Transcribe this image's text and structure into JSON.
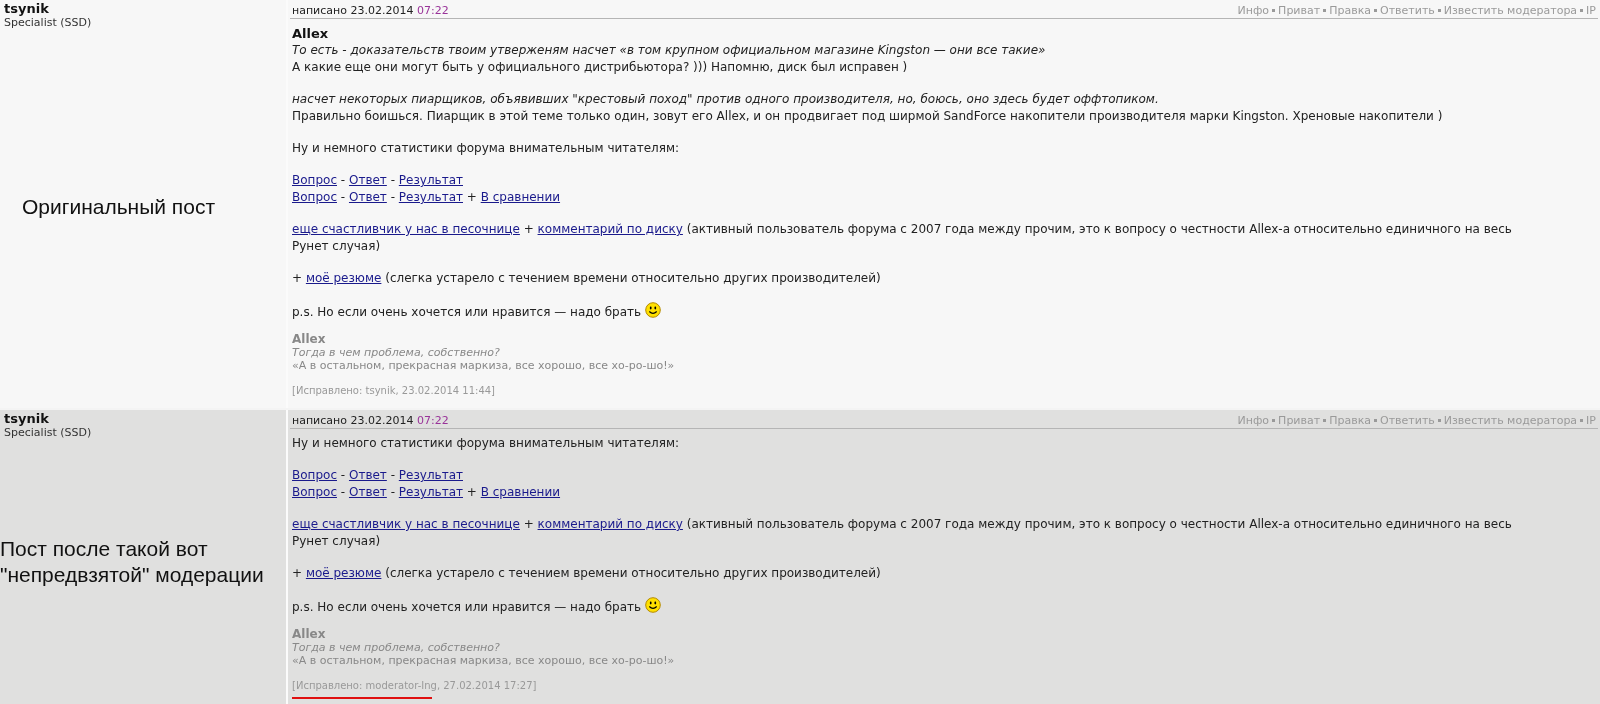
{
  "posts": [
    {
      "author": "tsynik",
      "rank": "Specialist (SSD)",
      "annotation": [
        "Оригинальный пост"
      ],
      "date": "написано 23.02.2014",
      "time": "07:22",
      "actions": [
        "Инфо",
        "Приват",
        "Правка",
        "Ответить",
        "Известить модератора",
        "IP"
      ],
      "body": [
        [
          {
            "kind": "author",
            "segments": [
              {
                "text": "Allex",
                "link": false
              }
            ]
          },
          {
            "kind": "quote",
            "segments": [
              {
                "text": "То есть - доказательств твоим утверженям насчет «в том крупном официальном магазине Kingston — они все такие»",
                "link": false
              }
            ]
          },
          {
            "kind": "text",
            "segments": [
              {
                "text": "А какие еще они могут быть у официального дистрибьютора? ))) Напомню, диск был исправен )",
                "link": false
              }
            ]
          }
        ],
        [
          {
            "kind": "quote",
            "segments": [
              {
                "text": "насчет некоторых пиарщиков, объявивших \"крестовый поход\" против одного производителя, но, боюсь, оно здесь будет оффтопиком.",
                "link": false
              }
            ]
          },
          {
            "kind": "text",
            "segments": [
              {
                "text": "Правильно боишься. Пиарщик в этой теме только один, зовут его Allex, и он продвигает под ширмой SandForce накопители производителя марки Kingston. Хреновые накопители )",
                "link": false
              }
            ]
          }
        ],
        [
          {
            "kind": "text",
            "segments": [
              {
                "text": "Ну и немного статистики форума внимательным читателям:",
                "link": false
              }
            ]
          }
        ],
        [
          {
            "kind": "text",
            "segments": [
              {
                "text": "Вопрос",
                "link": true
              },
              {
                "text": " - ",
                "link": false
              },
              {
                "text": "Ответ",
                "link": true
              },
              {
                "text": " - ",
                "link": false
              },
              {
                "text": "Результат",
                "link": true
              }
            ]
          },
          {
            "kind": "text",
            "segments": [
              {
                "text": "Вопрос",
                "link": true
              },
              {
                "text": " - ",
                "link": false
              },
              {
                "text": "Ответ",
                "link": true
              },
              {
                "text": " - ",
                "link": false
              },
              {
                "text": "Результат",
                "link": true
              },
              {
                "text": " + ",
                "link": false
              },
              {
                "text": "В сравнении",
                "link": true
              }
            ]
          }
        ],
        [
          {
            "kind": "text",
            "segments": [
              {
                "text": "еще счастливчик у нас в песочнице",
                "link": true
              },
              {
                "text": " + ",
                "link": false
              },
              {
                "text": "комментарий по диску",
                "link": true
              },
              {
                "text": " (активный пользователь форума с 2007 года между прочим, это к вопросу о честности Allex-а относительно единичного на весь Рунет случая)",
                "link": false
              }
            ]
          }
        ],
        [
          {
            "kind": "text",
            "segments": [
              {
                "text": "+ ",
                "link": false
              },
              {
                "text": "моё резюме",
                "link": true
              },
              {
                "text": " (слегка устарело с течением времени относительно других производителей)",
                "link": false
              }
            ]
          }
        ],
        [
          {
            "kind": "text",
            "smiley": true,
            "segments": [
              {
                "text": "p.s. Но если очень хочется или нравится — надо брать",
                "link": false
              }
            ]
          }
        ]
      ],
      "signature": {
        "name": "Allex",
        "lines": [
          "Тогда в чем проблема, собственно?",
          "«А в остальном, прекрасная маркиза, все хорошо, все хо-ро-шо!»"
        ]
      },
      "edited": {
        "text": "[Исправлено: tsynik, 23.02.2014 11:44]",
        "highlighted": false
      }
    },
    {
      "author": "tsynik",
      "rank": "Specialist (SSD)",
      "annotation": [
        "Пост после такой вот",
        "\"непредвзятой\" модерации"
      ],
      "date": "написано 23.02.2014",
      "time": "07:22",
      "actions": [
        "Инфо",
        "Приват",
        "Правка",
        "Ответить",
        "Известить модератора",
        "IP"
      ],
      "body": [
        [
          {
            "kind": "text",
            "segments": [
              {
                "text": "Ну и немного статистики форума внимательным читателям:",
                "link": false
              }
            ]
          }
        ],
        [
          {
            "kind": "text",
            "segments": [
              {
                "text": "Вопрос",
                "link": true
              },
              {
                "text": " - ",
                "link": false
              },
              {
                "text": "Ответ",
                "link": true
              },
              {
                "text": " - ",
                "link": false
              },
              {
                "text": "Результат",
                "link": true
              }
            ]
          },
          {
            "kind": "text",
            "segments": [
              {
                "text": "Вопрос",
                "link": true
              },
              {
                "text": " - ",
                "link": false
              },
              {
                "text": "Ответ",
                "link": true
              },
              {
                "text": " - ",
                "link": false
              },
              {
                "text": "Результат",
                "link": true
              },
              {
                "text": " + ",
                "link": false
              },
              {
                "text": "В сравнении",
                "link": true
              }
            ]
          }
        ],
        [
          {
            "kind": "text",
            "segments": [
              {
                "text": "еще счастливчик у нас в песочнице",
                "link": true
              },
              {
                "text": " + ",
                "link": false
              },
              {
                "text": "комментарий по диску",
                "link": true
              },
              {
                "text": " (активный пользователь форума с 2007 года между прочим, это к вопросу о честности Allex-а относительно единичного на весь Рунет случая)",
                "link": false
              }
            ]
          }
        ],
        [
          {
            "kind": "text",
            "segments": [
              {
                "text": "+ ",
                "link": false
              },
              {
                "text": "моё резюме",
                "link": true
              },
              {
                "text": " (слегка устарело с течением времени относительно других производителей)",
                "link": false
              }
            ]
          }
        ],
        [
          {
            "kind": "text",
            "smiley": true,
            "segments": [
              {
                "text": "p.s. Но если очень хочется или нравится — надо брать",
                "link": false
              }
            ]
          }
        ]
      ],
      "signature": {
        "name": "Allex",
        "lines": [
          "Тогда в чем проблема, собственно?",
          "«А в остальном, прекрасная маркиза, все хорошо, все хо-ро-шо!»"
        ]
      },
      "edited": {
        "text": "[Исправлено: moderator-Ing, 27.02.2014 17:27]",
        "highlighted": true
      }
    }
  ]
}
